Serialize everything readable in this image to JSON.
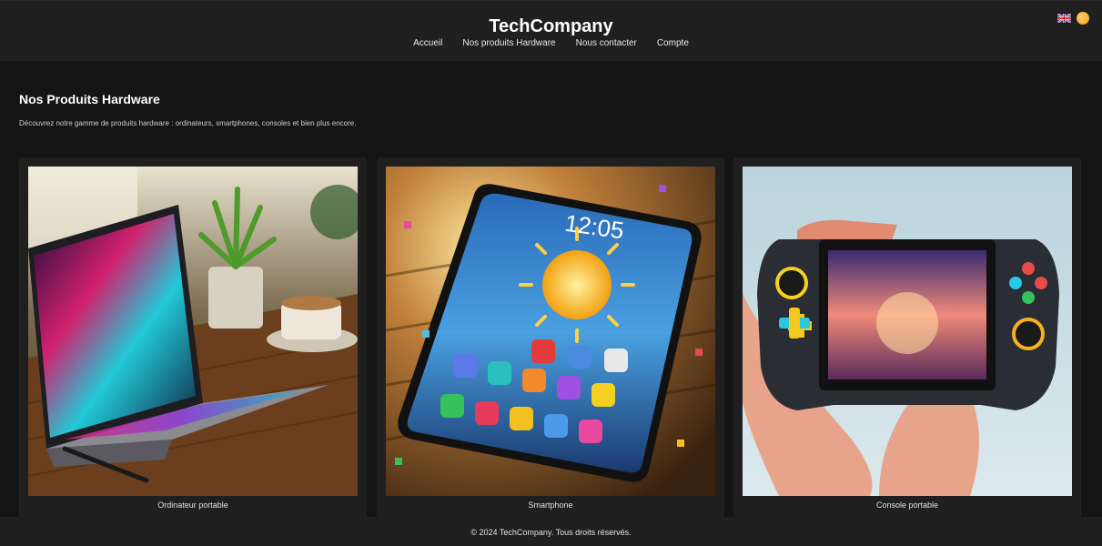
{
  "header": {
    "brand": "TechCompany",
    "nav": [
      "Accueil",
      "Nos produits Hardware",
      "Nous contacter",
      "Compte"
    ],
    "language_icon": "uk-flag-icon",
    "theme_icon": "sun-icon"
  },
  "main": {
    "title": "Nos Produits Hardware",
    "description": "Découvrez notre gamme de produits hardware : ordinateurs, smartphones, consoles et bien plus encore."
  },
  "products": [
    {
      "caption": "Ordinateur portable",
      "image": "laptop-image"
    },
    {
      "caption": "Smartphone",
      "image": "smartphone-image",
      "screen_time": "12:05"
    },
    {
      "caption": "Console portable",
      "image": "handheld-console-image"
    }
  ],
  "footer": {
    "text": "© 2024 TechCompany. Tous droits réservés."
  },
  "colors": {
    "page_bg": "#141414",
    "bar_bg": "#1f1f1f",
    "text": "#ffffff"
  }
}
